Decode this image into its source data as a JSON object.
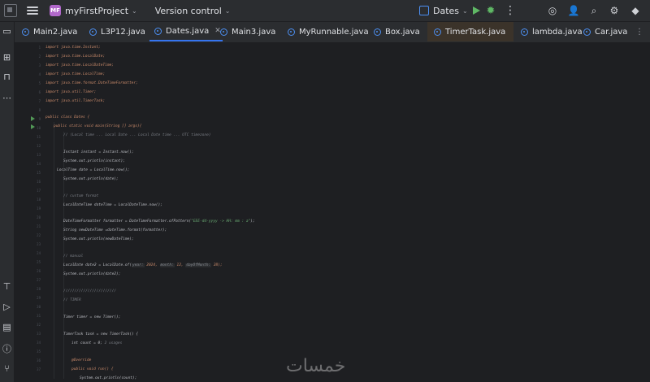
{
  "titlebar": {
    "project_badge": "MF",
    "project_name": "myFirstProject",
    "version_control": "Version control",
    "run_config": "Dates"
  },
  "tabs": [
    {
      "label": "Main2.java"
    },
    {
      "label": "L3P12.java"
    },
    {
      "label": "Dates.java",
      "close": "✕"
    },
    {
      "label": "Main3.java"
    },
    {
      "label": "MyRunnable.java"
    },
    {
      "label": "Box.java"
    },
    {
      "label": "TimerTask.java"
    },
    {
      "label": "lambda.java"
    },
    {
      "label": "Car.java"
    }
  ],
  "code": {
    "l1": "import java.time.Instant;",
    "l2": "import java.time.LocalDate;",
    "l3": "import java.time.LocalDateTime;",
    "l4": "import java.time.LocalTime;",
    "l5": "import java.time.format.DateTimeFormatter;",
    "l6": "import java.util.Timer;",
    "l7": "import java.util.TimerTask;",
    "l8": "public class Dates {",
    "l9": "public static void main(String [] args){",
    "l10": "// (Local time ... Local Date ... Local Date time ... UTC timezone)",
    "l11": "Instant instant = Instant.now();",
    "l12": "System.out.println(instant);",
    "l13": "LocalTime date = LocalTime.now();",
    "l14": "System.out.println(date);",
    "l15": "// custom format",
    "l16": "LocalDateTime dateTime = LocalDateTime.now();",
    "l17a": "DateTimeFormatter formatter = DateTimeFormatter.ofPattern(",
    "l17b": "\"EEE-dd-yyyy -> HH: mm : a\"",
    "l17c": ");",
    "l18": "String newDateTime =dateTime.format(formatter);",
    "l19": "System.out.println(newDateTime);",
    "l20": "// manual",
    "l21a": "LocalDate date2 = LocalDate.of(",
    "l21_h1": "year:",
    "l21_v1": " 2024, ",
    "l21_h2": "month:",
    "l21_v2": " 12, ",
    "l21_h3": "dayOfMonth:",
    "l21_v3": " 28);",
    "l22": "System.out.println(date2);",
    "l23": "////////////////////////",
    "l24": "// TIMER",
    "l25": "Timer timer = new Timer();",
    "l26": "TimerTask task = new TimerTask() {",
    "l27a": "int count = 0;",
    "l27b": "2 usages",
    "l28": "@Override",
    "l29": "public void run() {",
    "l30": "System.out.println(count);"
  },
  "watermark": "خمسات"
}
